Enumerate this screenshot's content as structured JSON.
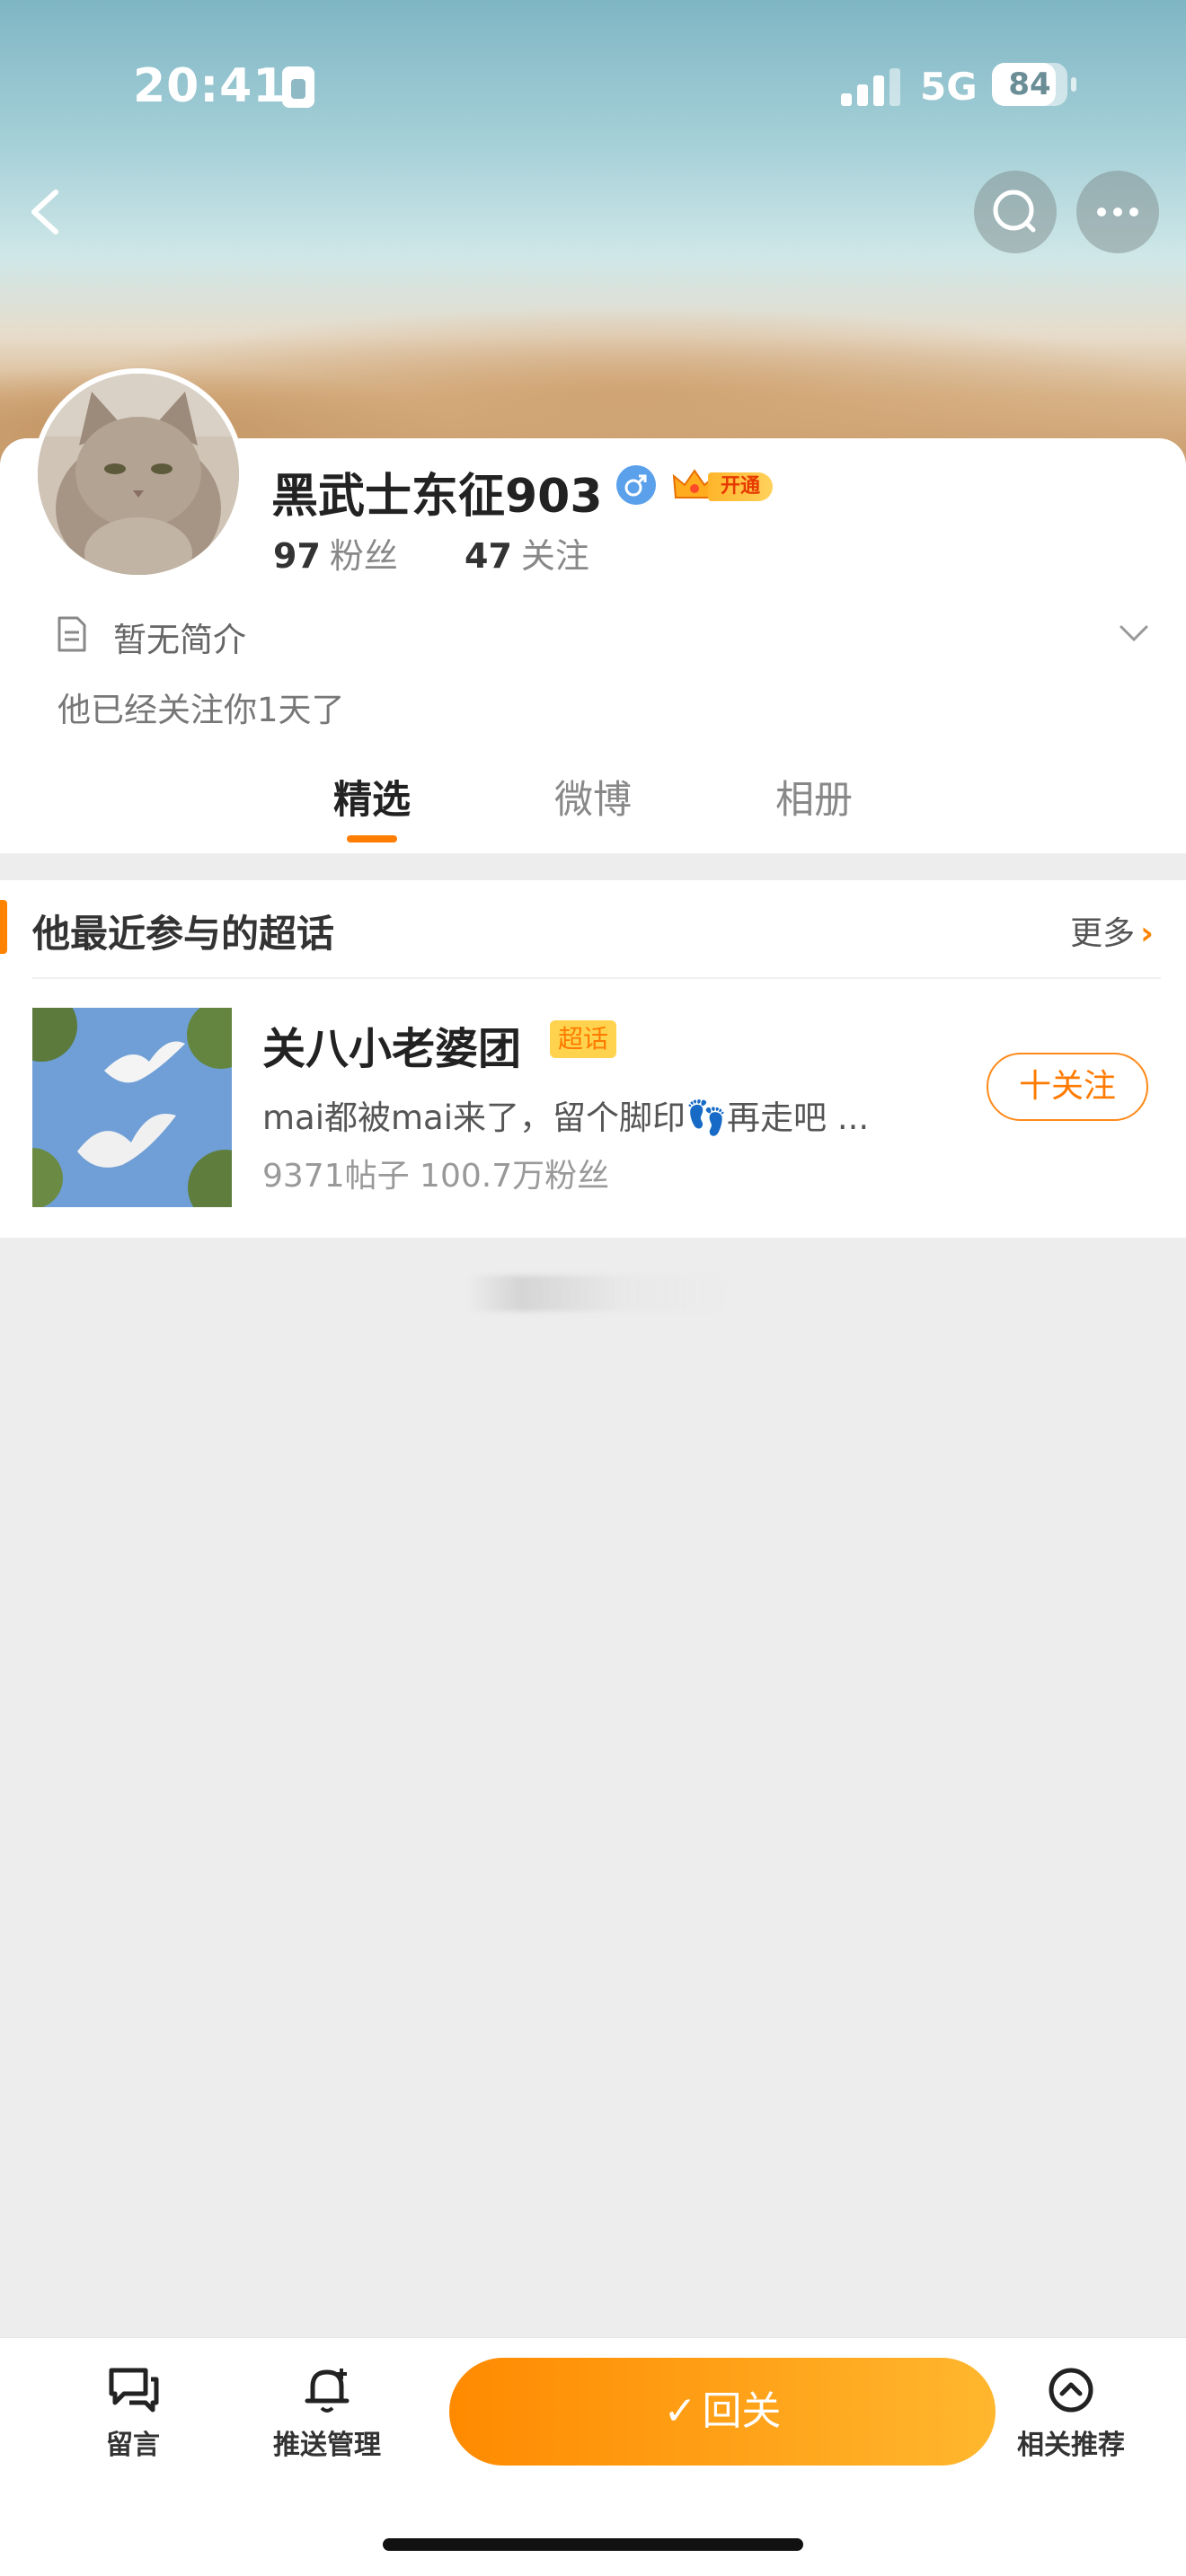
{
  "status_bar": {
    "time": "20:41",
    "network": "5G",
    "battery": "84",
    "battery_level": 0.84
  },
  "header": {
    "back_icon": "chevron-left-icon",
    "search_icon": "search-icon",
    "more_icon": "more-horizontal-icon"
  },
  "profile": {
    "username": "黑武士东征903",
    "gender_icon": "male-icon",
    "vip_label": "开通",
    "followers_count": "97",
    "followers_label": "粉丝",
    "following_count": "47",
    "following_label": "关注",
    "bio": "暂无简介",
    "follow_note": "他已经关注你1天了"
  },
  "tabs": [
    {
      "label": "精选",
      "active": true
    },
    {
      "label": "微博",
      "active": false
    },
    {
      "label": "相册",
      "active": false
    }
  ],
  "super_topics": {
    "title": "他最近参与的超话",
    "more_label": "更多",
    "items": [
      {
        "name": "关八小老婆团",
        "tag": "超话",
        "description": "mai都被mai来了，留个脚印👣再走吧 ...",
        "stats": "9371帖子 100.7万粉丝",
        "follow_label": "十关注"
      }
    ]
  },
  "bottom_bar": {
    "message_label": "留言",
    "push_label": "推送管理",
    "follow_back_label": "回关",
    "related_label": "相关推荐"
  },
  "colors": {
    "accent": "#ff8200",
    "follow_gradient_start": "#ff8a00",
    "follow_gradient_end": "#ffb72e",
    "vip": "#ffb52b"
  }
}
